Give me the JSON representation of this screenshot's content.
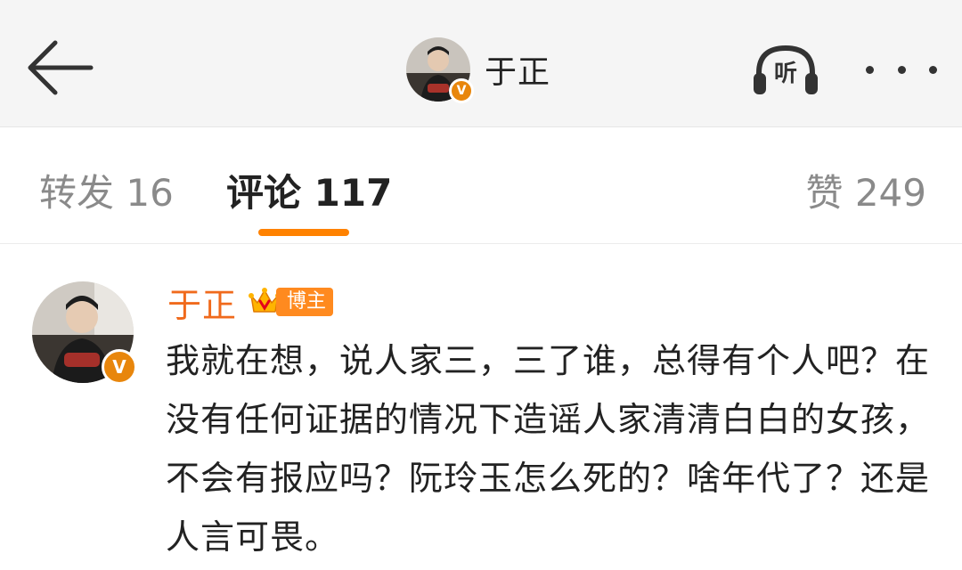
{
  "header": {
    "title": "于正",
    "listen_label": "听",
    "verified_mark": "V"
  },
  "tabs": [
    {
      "label": "转发 16"
    },
    {
      "label": "评论 117"
    },
    {
      "label": "赞 249"
    }
  ],
  "comment": {
    "author": "于正",
    "badge": "博主",
    "verified_mark": "V",
    "text": "我就在想，说人家三，三了谁，总得有个人吧？在没有任何证据的情况下造谣人家清清白白的女孩，不会有报应吗？阮玲玉怎么死的？啥年代了？还是人言可畏。"
  },
  "colors": {
    "accent": "#ff8200",
    "author_name": "#f06a1c",
    "verified": "#e8860c",
    "header_bg": "#f5f5f5"
  },
  "icons": [
    "back-arrow-icon",
    "listen-headphone-icon",
    "more-dots-icon",
    "crown-icon",
    "verified-icon"
  ]
}
